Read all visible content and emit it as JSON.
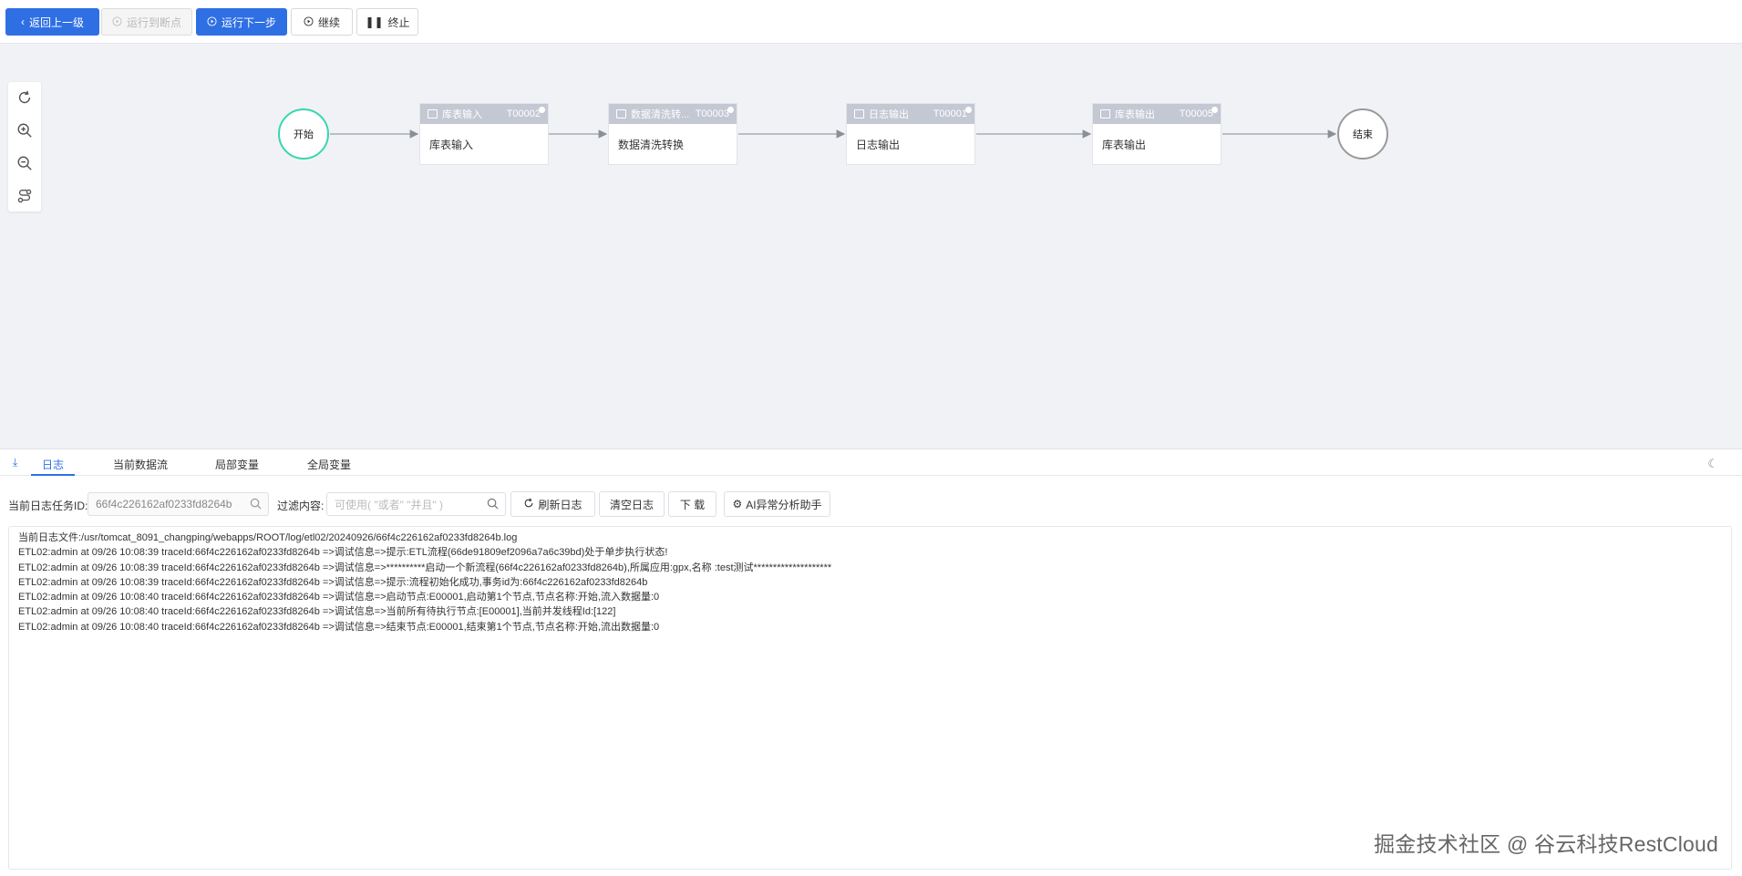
{
  "toolbar": {
    "back_label": "返回上一级",
    "run_to_breakpoint_label": "运行到断点",
    "run_next_label": "运行下一步",
    "continue_label": "继续",
    "stop_label": "终止"
  },
  "flow": {
    "start_label": "开始",
    "end_label": "结束",
    "tasks": [
      {
        "header": "库表输入",
        "id": "T00002",
        "body": "库表输入"
      },
      {
        "header": "数据清洗转...",
        "id": "T00003",
        "body": "数据清洗转换"
      },
      {
        "header": "日志输出",
        "id": "T00001",
        "body": "日志输出"
      },
      {
        "header": "库表输出",
        "id": "T00005",
        "body": "库表输出"
      }
    ]
  },
  "tabs": [
    "日志",
    "当前数据流",
    "局部变量",
    "全局变量"
  ],
  "filter": {
    "task_id_label": "当前日志任务ID:",
    "task_id_value": "66f4c226162af0233fd8264b",
    "content_label": "过滤内容:",
    "content_placeholder": "可使用( \"或者\"  \"并且\" )",
    "refresh_label": "刷新日志",
    "clear_label": "清空日志",
    "download_label": "下 载",
    "ai_label": "AI异常分析助手"
  },
  "log_lines": [
    "当前日志文件:/usr/tomcat_8091_changping/webapps/ROOT/log/etl02/20240926/66f4c226162af0233fd8264b.log",
    "ETL02:admin at 09/26 10:08:39 traceId:66f4c226162af0233fd8264b =>调试信息=>提示:ETL流程(66de91809ef2096a7a6c39bd)处于单步执行状态!",
    "ETL02:admin at 09/26 10:08:39 traceId:66f4c226162af0233fd8264b =>调试信息=>**********启动一个新流程(66f4c226162af0233fd8264b),所属应用:gpx,名称 :test测试********************",
    "ETL02:admin at 09/26 10:08:39 traceId:66f4c226162af0233fd8264b =>调试信息=>提示:流程初始化成功,事务id为:66f4c226162af0233fd8264b",
    "ETL02:admin at 09/26 10:08:40 traceId:66f4c226162af0233fd8264b =>调试信息=>启动节点:E00001,启动第1个节点,节点名称:开始,流入数据量:0",
    "ETL02:admin at 09/26 10:08:40 traceId:66f4c226162af0233fd8264b =>调试信息=>当前所有待执行节点:[E00001],当前并发线程Id:[122]",
    "ETL02:admin at 09/26 10:08:40 traceId:66f4c226162af0233fd8264b =>调试信息=>结束节点:E00001,结束第1个节点,节点名称:开始,流出数据量:0"
  ],
  "watermark": "掘金技术社区 @ 谷云科技RestCloud",
  "colors": {
    "primary": "#2f6fe4",
    "start_node_border": "#37d6b0",
    "task_header": "#c3c8d3",
    "canvas_bg": "#f1f2f5"
  }
}
